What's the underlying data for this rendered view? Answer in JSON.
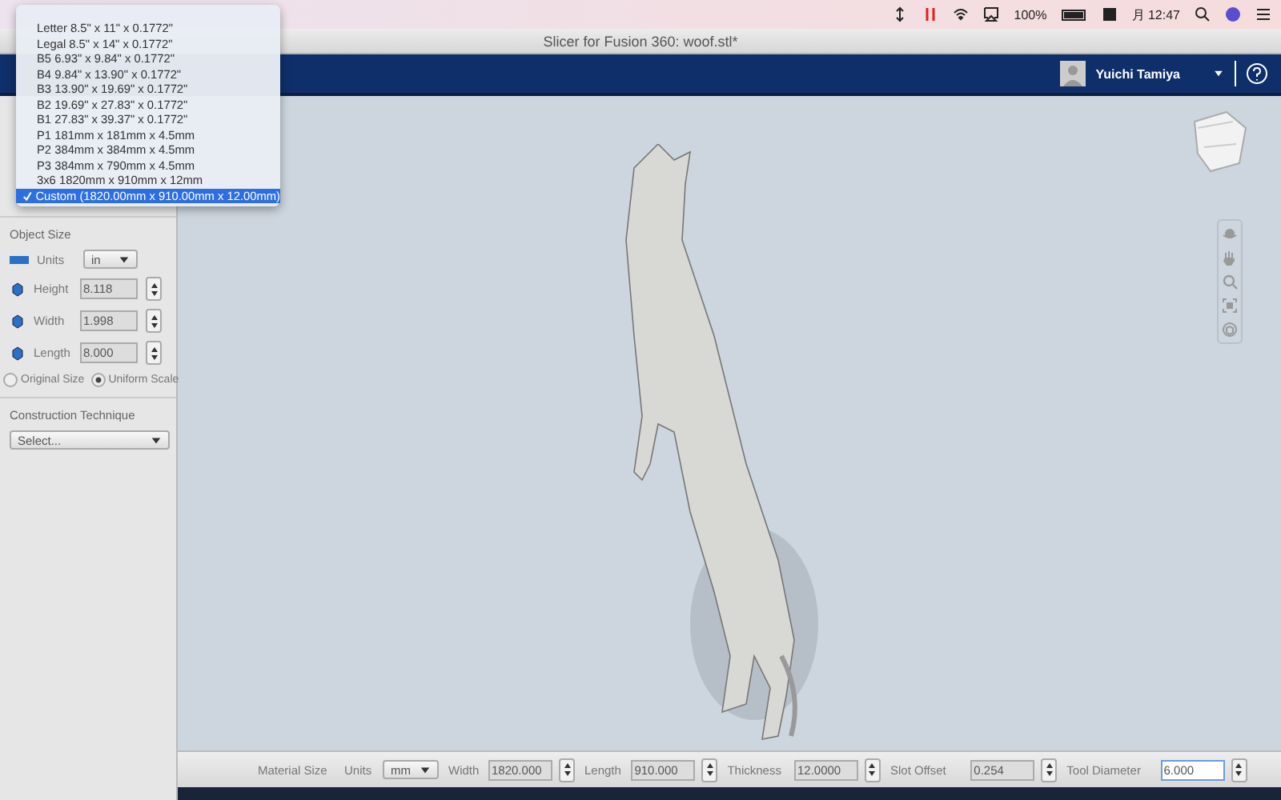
{
  "menu_bar": {
    "battery": "100%",
    "clock": "月 12:47"
  },
  "window": {
    "title": "Slicer for Fusion 360: woof.stl*"
  },
  "header": {
    "user": "Yuichi Tamiya"
  },
  "material_dropdown": {
    "items": [
      {
        "label": "Letter 8.5\" x 11\" x 0.1772\"",
        "selected": false
      },
      {
        "label": "Legal 8.5\" x 14\" x 0.1772\"",
        "selected": false
      },
      {
        "label": "B5 6.93\" x 9.84\" x 0.1772\"",
        "selected": false
      },
      {
        "label": "B4 9.84\" x 13.90\" x 0.1772\"",
        "selected": false
      },
      {
        "label": "B3 13.90\" x 19.69\" x 0.1772\"",
        "selected": false
      },
      {
        "label": "B2 19.69\" x 27.83\" x 0.1772\"",
        "selected": false
      },
      {
        "label": "B1 27.83\" x 39.37\" x 0.1772\"",
        "selected": false
      },
      {
        "label": "P1 181mm x 181mm x 4.5mm",
        "selected": false
      },
      {
        "label": "P2 384mm x 384mm x 4.5mm",
        "selected": false
      },
      {
        "label": "P3 384mm x 790mm x 4.5mm",
        "selected": false
      },
      {
        "label": "3x6 1820mm x 910mm x 12mm",
        "selected": false
      },
      {
        "label": "Custom (1820.00mm x 910.00mm x 12.00mm)",
        "selected": true
      }
    ]
  },
  "object_size": {
    "title": "Object Size",
    "units_label": "Units",
    "units": "in",
    "fields": [
      {
        "label": "Height",
        "value": "8.118"
      },
      {
        "label": "Width",
        "value": "1.998"
      },
      {
        "label": "Length",
        "value": "8.000"
      }
    ],
    "options": [
      {
        "label": "Original Size",
        "selected": false
      },
      {
        "label": "Uniform Scale",
        "selected": true
      }
    ]
  },
  "construction": {
    "title": "Construction Technique",
    "select": "Select..."
  },
  "bottom_bar": {
    "title": "Material Size",
    "units_label": "Units",
    "units": "mm",
    "fields": [
      {
        "label": "Width",
        "value": "1820.000",
        "focused": false
      },
      {
        "label": "Length",
        "value": "910.000",
        "focused": false
      },
      {
        "label": "Thickness",
        "value": "12.0000",
        "focused": false
      },
      {
        "label": "Slot Offset",
        "value": "0.254",
        "focused": false
      },
      {
        "label": "Tool Diameter",
        "value": "6.000",
        "focused": true
      }
    ]
  }
}
